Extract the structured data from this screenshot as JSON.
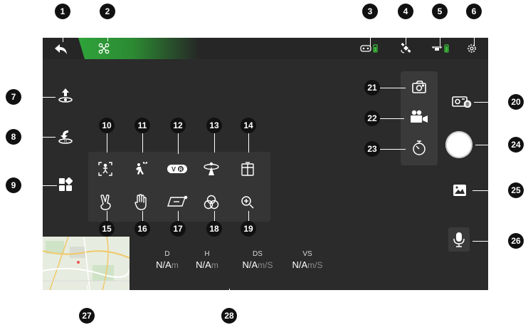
{
  "callouts": [
    "1",
    "2",
    "3",
    "4",
    "5",
    "6",
    "7",
    "8",
    "9",
    "10",
    "11",
    "12",
    "13",
    "14",
    "15",
    "16",
    "17",
    "18",
    "19",
    "20",
    "21",
    "22",
    "23",
    "24",
    "25",
    "26",
    "27",
    "28"
  ],
  "topbar": {
    "back_icon": "back-arrow-icon",
    "aircraft_icon": "aircraft-icon",
    "remote_controller_icon": "remote-controller-battery-icon",
    "gps_icon": "gps-satellite-icon",
    "aircraft_battery_icon": "aircraft-battery-icon",
    "settings_icon": "gear-icon"
  },
  "left_controls": {
    "takeoff_icon": "auto-takeoff-icon",
    "return_home_icon": "return-to-home-icon",
    "smart_menu_icon": "intelligent-menu-icon"
  },
  "smart_menu": {
    "items": [
      "focus-track-icon",
      "follow-me-icon",
      "vr-icon",
      "orbit-icon",
      "panel-icon",
      "gesture-v-icon",
      "palm-control-icon",
      "tapfly-icon",
      "filter-icon",
      "zoom-in-icon"
    ]
  },
  "camera": {
    "modes": [
      "photo-mode-icon",
      "video-mode-icon",
      "timelapse-mode-icon"
    ],
    "camera_settings_icon": "camera-settings-icon",
    "shutter": "shutter-button",
    "gallery_icon": "gallery-icon",
    "mic_icon": "microphone-icon"
  },
  "telemetry": [
    {
      "label": "D",
      "value": "N/A",
      "unit": "m"
    },
    {
      "label": "H",
      "value": "N/A",
      "unit": "m"
    },
    {
      "label": "DS",
      "value": "N/A",
      "unit": "m/S"
    },
    {
      "label": "VS",
      "value": "N/A",
      "unit": "m/S"
    }
  ],
  "colors": {
    "screen_bg": "#2b2b2b",
    "accent_green": "#2fa33a",
    "battery_green": "#3cc63c"
  }
}
